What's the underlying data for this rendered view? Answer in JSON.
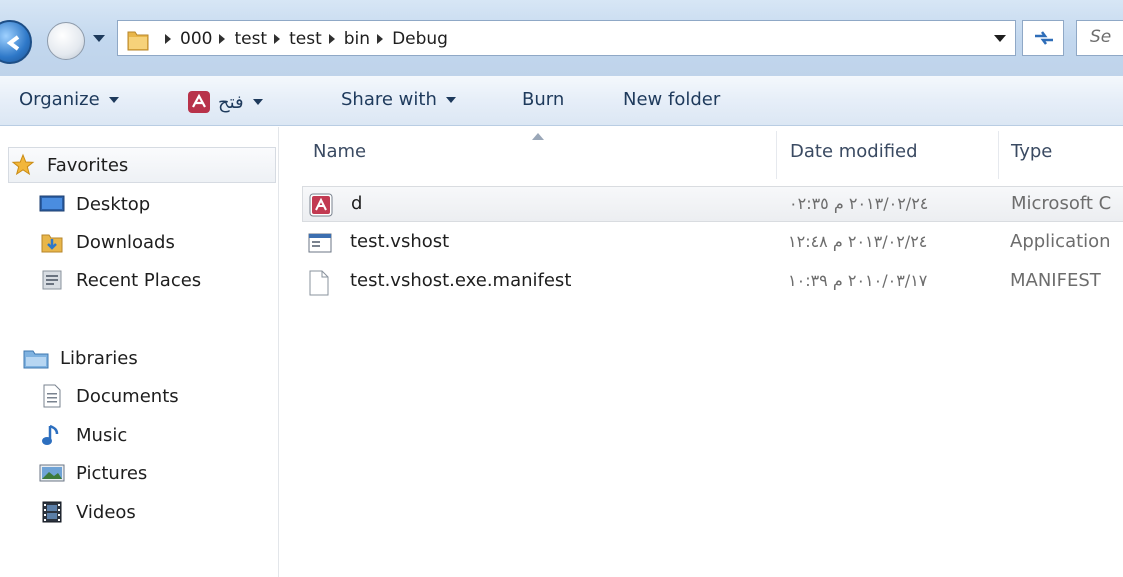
{
  "address_bar": {
    "crumbs": [
      "000",
      "test",
      "test",
      "bin",
      "Debug"
    ],
    "search_placeholder": "Se"
  },
  "toolbar": {
    "organize": "Organize",
    "open_with": "فتح",
    "share_with": "Share with",
    "burn": "Burn",
    "new_folder": "New folder"
  },
  "nav": {
    "favorites": {
      "label": "Favorites",
      "items": [
        {
          "label": "Desktop",
          "icon": "desktop-icon"
        },
        {
          "label": "Downloads",
          "icon": "downloads-folder-icon"
        },
        {
          "label": "Recent Places",
          "icon": "recent-places-icon"
        }
      ]
    },
    "libraries": {
      "label": "Libraries",
      "items": [
        {
          "label": "Documents",
          "icon": "documents-icon"
        },
        {
          "label": "Music",
          "icon": "music-icon"
        },
        {
          "label": "Pictures",
          "icon": "pictures-icon"
        },
        {
          "label": "Videos",
          "icon": "videos-icon"
        }
      ]
    }
  },
  "columns": {
    "name": "Name",
    "date_modified": "Date modified",
    "type": "Type"
  },
  "files": [
    {
      "name": "d",
      "date": "٢٠١٣/٠٢/٢٤ م ٠٢:٣٥",
      "type": "Microsoft C",
      "icon": "access-file-icon",
      "selected": true
    },
    {
      "name": "test.vshost",
      "date": "٢٠١٣/٠٢/٢٤ م ١٢:٤٨",
      "type": "Application",
      "icon": "application-icon",
      "selected": false
    },
    {
      "name": "test.vshost.exe.manifest",
      "date": "٢٠١٠/٠٣/١٧ م ١٠:٣٩",
      "type": "MANIFEST",
      "icon": "file-icon",
      "selected": false
    }
  ],
  "colors": {
    "accent": "#2e78c8",
    "header_text": "#3a4a62",
    "selection_border": "#d9dce0"
  }
}
